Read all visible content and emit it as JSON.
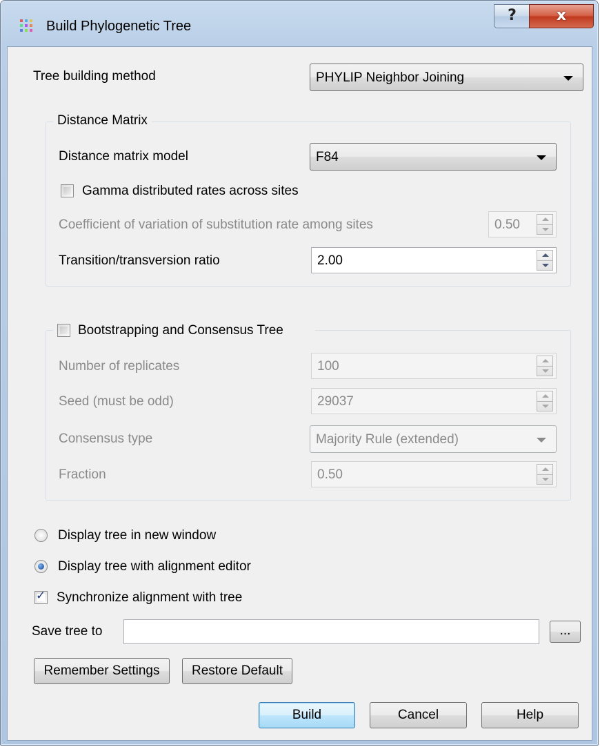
{
  "window": {
    "title": "Build Phylogenetic Tree",
    "help_glyph": "?",
    "close_glyph": "x"
  },
  "method": {
    "label": "Tree building method",
    "selected": "PHYLIP Neighbor Joining"
  },
  "distance_matrix": {
    "group_title": "Distance Matrix",
    "model_label": "Distance matrix model",
    "model_selected": "F84",
    "gamma_label": "Gamma distributed rates across sites",
    "gamma_checked": false,
    "coef_label": "Coefficient of variation of substitution rate among sites",
    "coef_value": "0.50",
    "ratio_label": "Transition/transversion ratio",
    "ratio_value": "2.00"
  },
  "bootstrap": {
    "group_title": "Bootstrapping and Consensus Tree",
    "checked": false,
    "replicates_label": "Number of replicates",
    "replicates_value": "100",
    "seed_label": "Seed (must be odd)",
    "seed_value": "29037",
    "consensus_label": "Consensus type",
    "consensus_selected": "Majority Rule (extended)",
    "fraction_label": "Fraction",
    "fraction_value": "0.50"
  },
  "display": {
    "new_window_label": "Display tree in new window",
    "with_editor_label": "Display tree with alignment editor",
    "selected": "with_editor",
    "sync_label": "Synchronize alignment with tree",
    "sync_checked": true
  },
  "save": {
    "label": "Save tree to",
    "value": "",
    "browse_label": "..."
  },
  "buttons": {
    "remember": "Remember Settings",
    "restore": "Restore Default",
    "build": "Build",
    "cancel": "Cancel",
    "help": "Help"
  },
  "colors": {
    "accent": "#3c7fb1",
    "close": "#c0391f",
    "disabled_text": "#8a8a8a"
  }
}
